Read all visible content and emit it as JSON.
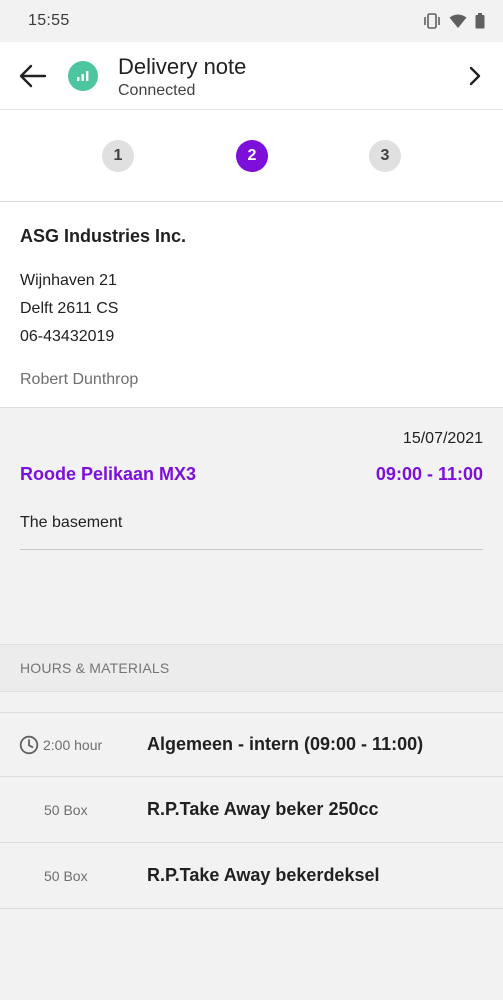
{
  "status_bar": {
    "time": "15:55"
  },
  "app_bar": {
    "title": "Delivery note",
    "subtitle": "Connected"
  },
  "stepper": {
    "steps": [
      "1",
      "2",
      "3"
    ],
    "active_index": 1
  },
  "customer": {
    "name": "ASG Industries Inc.",
    "address_line1": "Wijnhaven 21",
    "address_line2": "Delft 2611 CS",
    "phone": "06-43432019",
    "contact": "Robert Dunthrop"
  },
  "job": {
    "date": "15/07/2021",
    "name": "Roode Pelikaan MX3",
    "time_range": "09:00 - 11:00",
    "location": "The basement"
  },
  "section": {
    "title": "HOURS & MATERIALS"
  },
  "items": [
    {
      "qty": "2:00 hour",
      "description": "Algemeen - intern (09:00 - 11:00)"
    },
    {
      "qty": "50 Box",
      "description": "R.P.Take Away beker 250cc"
    },
    {
      "qty": "50 Box",
      "description": "R.P.Take Away bekerdeksel"
    }
  ],
  "colors": {
    "accent": "#7c0fd8",
    "badge": "#4cc5a0"
  }
}
